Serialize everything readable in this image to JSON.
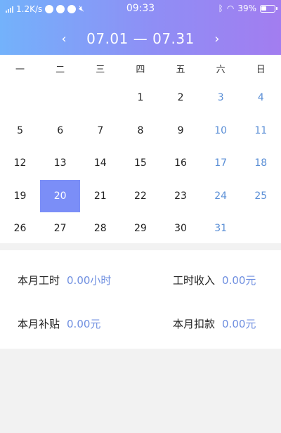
{
  "status_bar": {
    "network_speed": "1.2K/s",
    "time": "09:33",
    "battery": "39%"
  },
  "header": {
    "date_range": "07.01 — 07.31",
    "prev_icon": "chevron-left-icon",
    "next_icon": "chevron-right-icon"
  },
  "calendar": {
    "weekdays": [
      "一",
      "二",
      "三",
      "四",
      "五",
      "六",
      "日"
    ],
    "leading_blanks": 3,
    "days": [
      "1",
      "2",
      "3",
      "4",
      "5",
      "6",
      "7",
      "8",
      "9",
      "10",
      "11",
      "12",
      "13",
      "14",
      "15",
      "16",
      "17",
      "18",
      "19",
      "20",
      "21",
      "22",
      "23",
      "24",
      "25",
      "26",
      "27",
      "28",
      "29",
      "30",
      "31"
    ],
    "selected_day": "20",
    "weekend_color": "#5b8fd6",
    "selected_color": "#7b8ef7"
  },
  "summary": {
    "monthly_hours_label": "本月工时",
    "monthly_hours_value": "0.00小时",
    "hourly_income_label": "工时收入",
    "hourly_income_value": "0.00元",
    "subsidy_label": "本月补贴",
    "subsidy_value": "0.00元",
    "deduction_label": "本月扣款",
    "deduction_value": "0.00元"
  }
}
